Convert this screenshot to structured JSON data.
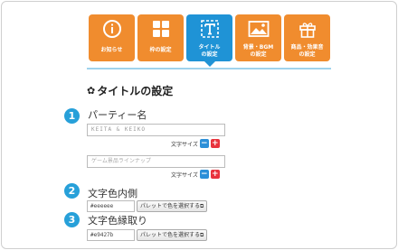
{
  "tabs": [
    {
      "label": "お知らせ",
      "icon": "info-icon",
      "active": false
    },
    {
      "label": "枠の設定",
      "icon": "grid-icon",
      "active": false
    },
    {
      "label": "タイトル\nの設定",
      "icon": "title-icon",
      "active": true
    },
    {
      "label": "背景・BGM\nの設定",
      "icon": "image-icon",
      "active": false
    },
    {
      "label": "商品・効果音\nの設定",
      "icon": "gift-icon",
      "active": false
    }
  ],
  "section": {
    "title": "タイトルの設定",
    "icon": "gear-icon"
  },
  "party_name": {
    "number": "1",
    "label": "パーティー名",
    "input1": "KEITA & KEIKO",
    "input2": "ゲーム景品ラインナップ",
    "size_label": "文字サイズ",
    "minus": "−",
    "plus": "+"
  },
  "inner_color": {
    "number": "2",
    "label": "文字色内側",
    "value": "#eeeeee",
    "button": "パレットで色を選択する"
  },
  "border_color": {
    "number": "3",
    "label": "文字色縁取り",
    "value": "#e9427b",
    "button": "パレットで色を選択する"
  },
  "colors": {
    "orange": "#f08c2e",
    "blue": "#1f93d6",
    "step": "#27a0d9"
  }
}
